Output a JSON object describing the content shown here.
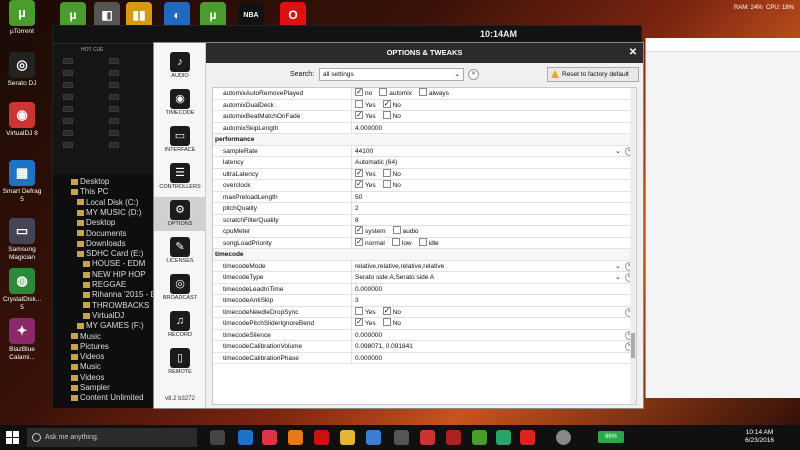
{
  "desktop_icons": [
    {
      "label": "µTorrent",
      "glyph": "µ",
      "color": "#4a9d2c"
    },
    {
      "label": "Serato DJ",
      "glyph": "◎",
      "color": "#222"
    },
    {
      "label": "VirtualDJ 8",
      "glyph": "◉",
      "color": "#c33"
    },
    {
      "label": "Smart Defrag 5",
      "glyph": "▦",
      "color": "#1e73c8"
    },
    {
      "label": "Samsung Magician",
      "glyph": "▭",
      "color": "#445"
    },
    {
      "label": "CrystalDisk... 5",
      "glyph": "◍",
      "color": "#2a8a3a"
    },
    {
      "label": "BlazBlue Calami...",
      "glyph": "✦",
      "color": "#8a2a6a"
    }
  ],
  "top_tray": {
    "ram": "RAM: 24%",
    "cpu": "CPU: 18%"
  },
  "vdj": {
    "clock": "10:14AM",
    "hot_cue": "HOT CUE",
    "explorer": [
      {
        "label": "Desktop",
        "indent": 0
      },
      {
        "label": "This PC",
        "indent": 0
      },
      {
        "label": "Local Disk (C:)",
        "indent": 1
      },
      {
        "label": "MY MUSIC (D:)",
        "indent": 1
      },
      {
        "label": "Desktop",
        "indent": 1
      },
      {
        "label": "Documents",
        "indent": 1
      },
      {
        "label": "Downloads",
        "indent": 1
      },
      {
        "label": "SDHC Card (E:)",
        "indent": 1
      },
      {
        "label": "HOUSE - EDM",
        "indent": 2
      },
      {
        "label": "NEW HIP HOP",
        "indent": 2
      },
      {
        "label": "REGGAE",
        "indent": 2
      },
      {
        "label": "Rihanna '2015 - Bitch B",
        "indent": 2
      },
      {
        "label": "THROWBACKS",
        "indent": 2
      },
      {
        "label": "VirtualDJ",
        "indent": 2
      },
      {
        "label": "MY GAMES (F:)",
        "indent": 1
      },
      {
        "label": "Music",
        "indent": 0
      },
      {
        "label": "Pictures",
        "indent": 0
      },
      {
        "label": "Videos",
        "indent": 0
      },
      {
        "label": "Music",
        "indent": 0
      },
      {
        "label": "Videos",
        "indent": 0
      },
      {
        "label": "Sampler",
        "indent": 0
      },
      {
        "label": "Content Unlimited",
        "indent": 0
      }
    ]
  },
  "dialog": {
    "title": "OPTIONS & TWEAKS",
    "close": "✕",
    "search_label": "Search:",
    "search_value": "all settings",
    "reset_label": "Reset to factory default",
    "version": "v8.2 b3272",
    "sidebar": [
      {
        "label": "AUDIO",
        "glyph": "♪",
        "active": false
      },
      {
        "label": "TIMECODE",
        "glyph": "◉",
        "active": false
      },
      {
        "label": "INTERFACE",
        "glyph": "▭",
        "active": false
      },
      {
        "label": "CONTROLLERS",
        "glyph": "☰",
        "active": false
      },
      {
        "label": "OPTIONS",
        "glyph": "⚙",
        "active": true
      },
      {
        "label": "LICENSES",
        "glyph": "✎",
        "active": false
      },
      {
        "label": "BROADCAST",
        "glyph": "◎",
        "active": false
      },
      {
        "label": "RECORD",
        "glyph": "♫",
        "active": false
      },
      {
        "label": "REMOTE",
        "glyph": "▯",
        "active": false
      }
    ],
    "rows": [
      {
        "type": "setting",
        "key": "automixAutoRemovePlayed",
        "opts": [
          {
            "t": "no",
            "on": true
          },
          {
            "t": "automix",
            "on": false
          },
          {
            "t": "always",
            "on": false
          }
        ]
      },
      {
        "type": "setting",
        "key": "automixDualDeck",
        "opts": [
          {
            "t": "Yes",
            "on": false
          },
          {
            "t": "No",
            "on": true
          }
        ]
      },
      {
        "type": "setting",
        "key": "automixBeatMatchOnFade",
        "opts": [
          {
            "t": "Yes",
            "on": true
          },
          {
            "t": "No",
            "on": false
          }
        ]
      },
      {
        "type": "setting",
        "key": "automixSkipLength",
        "value": "4.000000"
      },
      {
        "type": "section",
        "key": "performance"
      },
      {
        "type": "setting",
        "key": "sampleRate",
        "value": "44100",
        "select": true,
        "clear": true
      },
      {
        "type": "setting",
        "key": "latency",
        "value": "Automatic (64)"
      },
      {
        "type": "setting",
        "key": "ultraLatency",
        "opts": [
          {
            "t": "Yes",
            "on": true
          },
          {
            "t": "No",
            "on": false
          }
        ]
      },
      {
        "type": "setting",
        "key": "overclock",
        "opts": [
          {
            "t": "Yes",
            "on": true
          },
          {
            "t": "No",
            "on": false
          }
        ]
      },
      {
        "type": "setting",
        "key": "maxPreloadLength",
        "value": "50"
      },
      {
        "type": "setting",
        "key": "pitchQuality",
        "value": "2"
      },
      {
        "type": "setting",
        "key": "scratchFilterQuality",
        "value": "8"
      },
      {
        "type": "setting",
        "key": "cpuMeter",
        "opts": [
          {
            "t": "system",
            "on": true
          },
          {
            "t": "audio",
            "on": false
          }
        ]
      },
      {
        "type": "setting",
        "key": "songLoadPriority",
        "opts": [
          {
            "t": "normal",
            "on": true
          },
          {
            "t": "low",
            "on": false
          },
          {
            "t": "idle",
            "on": false
          }
        ]
      },
      {
        "type": "section",
        "key": "timecode"
      },
      {
        "type": "setting",
        "key": "timecodeMode",
        "value": "relative,relative,relative,relative",
        "select": true,
        "clear": true
      },
      {
        "type": "setting",
        "key": "timecodeType",
        "value": "Serato side A,Serato side A",
        "select": true,
        "clear": true
      },
      {
        "type": "setting",
        "key": "timecodeLeadInTime",
        "value": "0.000000"
      },
      {
        "type": "setting",
        "key": "timecodeAntiSkip",
        "value": "3"
      },
      {
        "type": "setting",
        "key": "timecodeNeedleDropSync",
        "opts": [
          {
            "t": "Yes",
            "on": false
          },
          {
            "t": "No",
            "on": true
          }
        ],
        "clear": true
      },
      {
        "type": "setting",
        "key": "timecodePitchSliderIgnoreBend",
        "opts": [
          {
            "t": "Yes",
            "on": true
          },
          {
            "t": "No",
            "on": false
          }
        ]
      },
      {
        "type": "setting",
        "key": "timecodeSilence",
        "value": "0.000000",
        "clear": true
      },
      {
        "type": "setting",
        "key": "timecodeCalibrationVolume",
        "value": "0.098071, 0.091841",
        "clear": true
      },
      {
        "type": "setting",
        "key": "timecodeCalibrationPhase",
        "value": "0.000000"
      }
    ]
  },
  "taskbar": {
    "cortana": "Ask me anything.",
    "battery": "86%",
    "time": "10:14 AM",
    "date": "6/23/2016"
  }
}
